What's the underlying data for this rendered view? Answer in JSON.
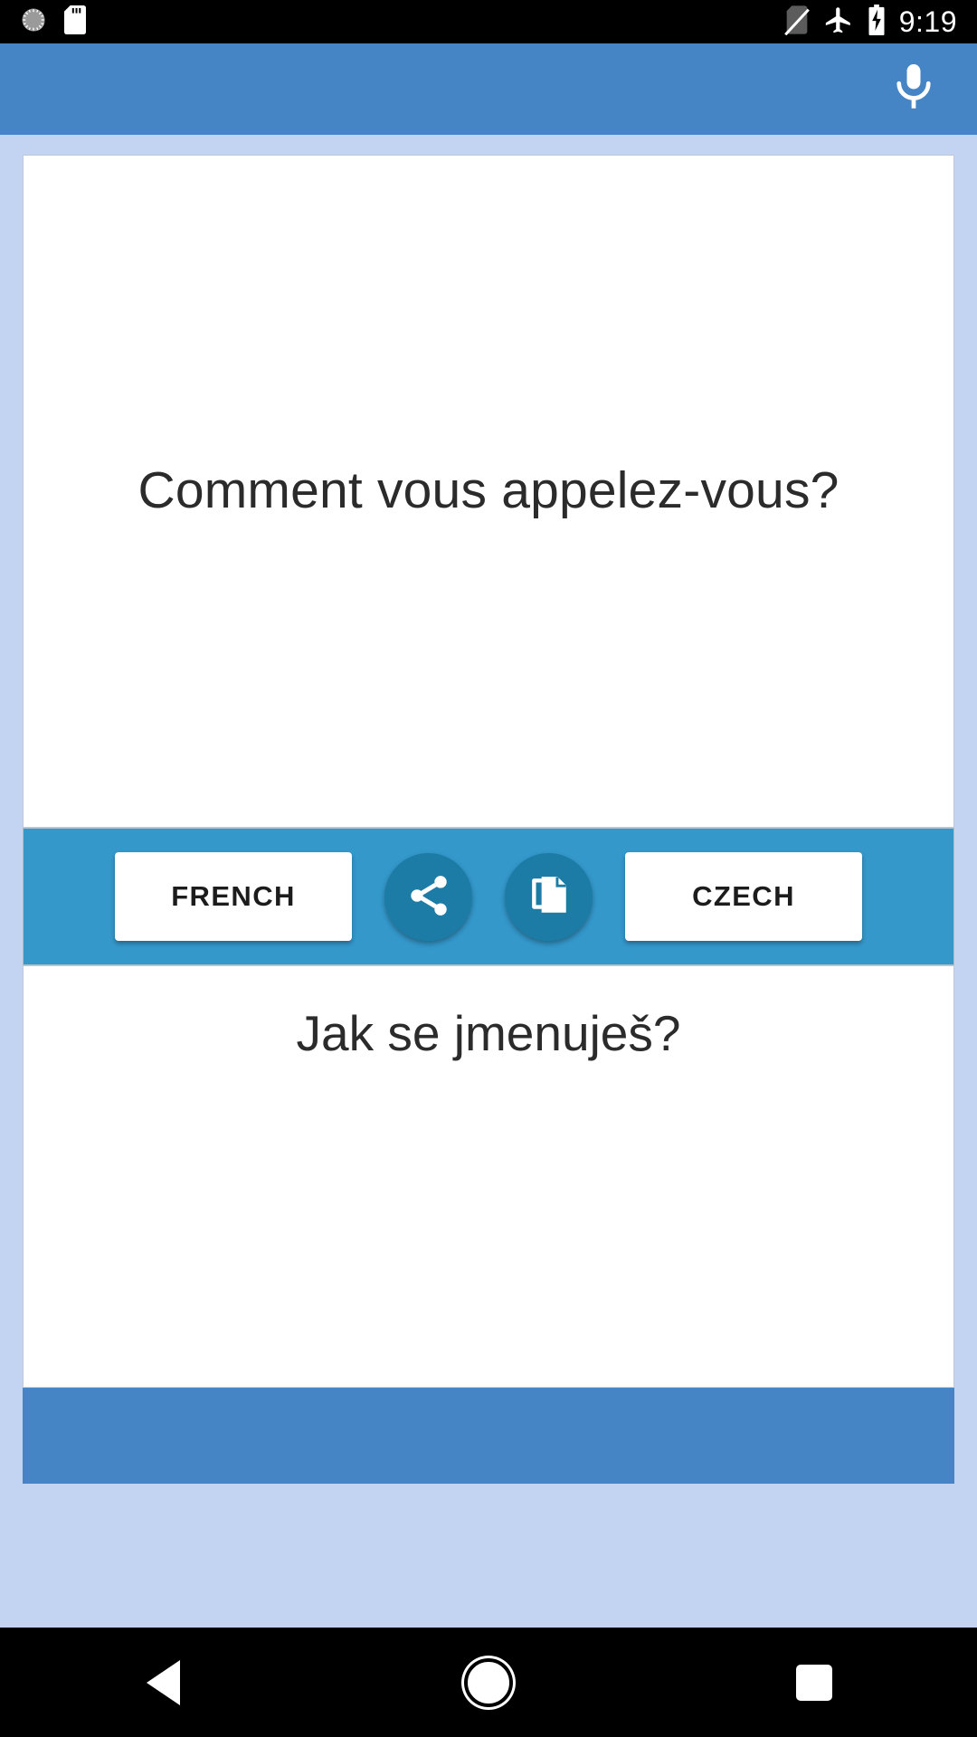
{
  "status_bar": {
    "icons_left": [
      "alarm-icon",
      "sd-card-icon"
    ],
    "icons_right": [
      "no-sim-icon",
      "airplane-mode-icon",
      "battery-charging-icon"
    ],
    "time": "9:19"
  },
  "app_bar": {
    "mic_icon": "microphone-icon",
    "background_color": "#4585c5"
  },
  "source_panel": {
    "text": "Comment vous appelez-vous?"
  },
  "toolbar": {
    "source_language": "FRENCH",
    "target_language": "CZECH",
    "share_icon": "share-icon",
    "copy_icon": "copy-icon",
    "background_color": "#3498cb",
    "fab_color": "#1d7ca5"
  },
  "target_panel": {
    "text": "Jak se jmenuješ?"
  },
  "footer": {
    "background_color": "#4585c5",
    "text": ""
  },
  "nav_bar": {
    "back": "back-icon",
    "home": "home-icon",
    "recents": "recents-icon"
  }
}
